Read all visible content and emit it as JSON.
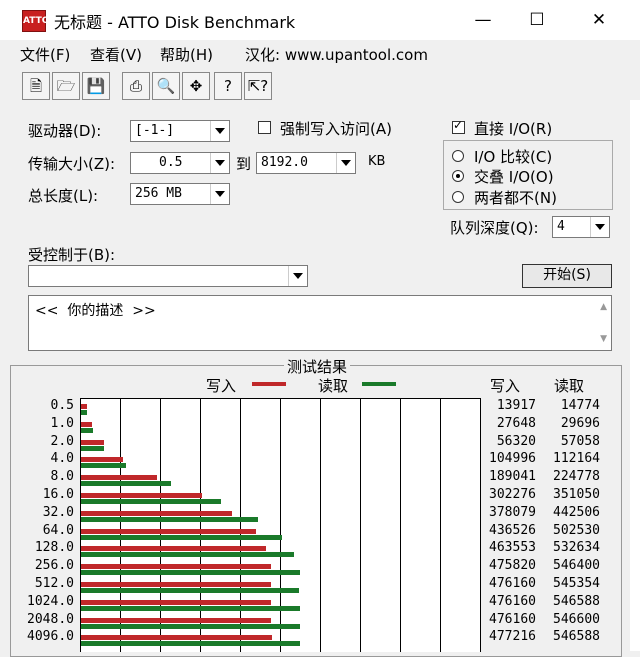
{
  "window": {
    "title": "无标题 - ATTO Disk Benchmark",
    "icon_text": "ATTO"
  },
  "menu": {
    "items": [
      "文件(F)",
      "查看(V)",
      "帮助(H)",
      "汉化: www.upantool.com"
    ]
  },
  "toolbar": {
    "icons": [
      "new-file-icon",
      "open-folder-icon",
      "save-icon",
      "print-icon",
      "print-preview-icon",
      "move-icon",
      "help-icon",
      "context-help-icon"
    ]
  },
  "form": {
    "drive_label": "驱动器(D):",
    "drive_value": "[-1-]",
    "force_write_label": "强制写入访问(A)",
    "transfer_label": "传输大小(Z):",
    "transfer_from": "0.5",
    "to_label": "到",
    "transfer_to": "8192.0",
    "kb_label": "KB",
    "total_label": "总长度(L):",
    "total_value": "256 MB",
    "direct_io_label": "直接 I/O(R)",
    "io_compare_label": "I/O 比较(C)",
    "overlap_io_label": "交叠 I/O(O)",
    "neither_label": "两者都不(N)",
    "queue_label": "队列深度(Q):",
    "queue_value": "4",
    "controlled_label": "受控制于(B):",
    "controlled_value": "",
    "start_button": "开始(S)",
    "description": "<<  你的描述  >>"
  },
  "results": {
    "title": "测试结果",
    "legend_write": "写入",
    "legend_read": "读取",
    "col_write": "写入",
    "col_read": "读取"
  },
  "colors": {
    "write": "#c0282a",
    "read": "#1a7a2a"
  },
  "chart_data": {
    "type": "bar",
    "orientation": "horizontal",
    "categories": [
      "0.5",
      "1.0",
      "2.0",
      "4.0",
      "8.0",
      "16.0",
      "32.0",
      "64.0",
      "128.0",
      "256.0",
      "512.0",
      "1024.0",
      "2048.0",
      "4096.0"
    ],
    "series": [
      {
        "name": "写入",
        "values": [
          13917,
          27648,
          56320,
          104996,
          189041,
          302276,
          378079,
          436526,
          463553,
          475820,
          476160,
          476160,
          476160,
          477216
        ]
      },
      {
        "name": "读取",
        "values": [
          14774,
          29696,
          57058,
          112164,
          224778,
          351050,
          442506,
          502530,
          532634,
          546400,
          545354,
          546588,
          546600,
          546588
        ]
      }
    ],
    "display_values": {
      "write": [
        "13917",
        "27648",
        "56320",
        "104996",
        "189041",
        "302276",
        "378079",
        "436526",
        "463553",
        "475820",
        "476160",
        "476160",
        "476160",
        "477216"
      ],
      "read": [
        "14774",
        "29696",
        "57058",
        "112164",
        "224778",
        "351050",
        "442506",
        "502530",
        "532634",
        "546400",
        "545354",
        "546588",
        "546600",
        "546588"
      ]
    },
    "xlim": [
      0,
      1000000
    ],
    "grid": true
  }
}
